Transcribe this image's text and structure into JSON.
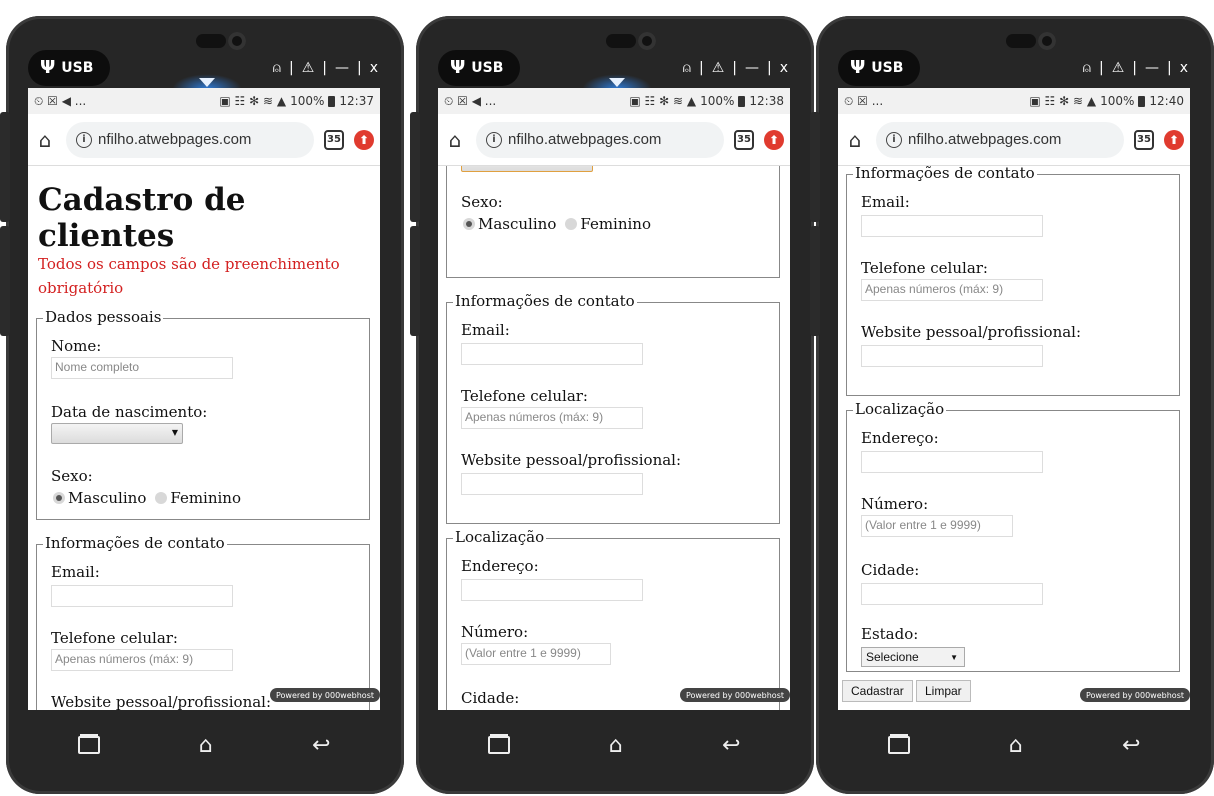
{
  "window": {
    "usb_label": "USB",
    "controls": [
      "⍝",
      "|",
      "⚠",
      "|",
      "—",
      "|",
      "x"
    ]
  },
  "phones": [
    {
      "time": "12:37",
      "battery": "100%",
      "notif": "⏲ ☒ ◀ ...",
      "url": "nfilho.atwebpages.com",
      "tabs_count": "35"
    },
    {
      "time": "12:38",
      "battery": "100%",
      "notif": "⏲ ☒ ◀ ...",
      "url": "nfilho.atwebpages.com",
      "tabs_count": "35"
    },
    {
      "time": "12:40",
      "battery": "100%",
      "notif": "⏲ ☒ ...",
      "url": "nfilho.atwebpages.com",
      "tabs_count": "35"
    }
  ],
  "form": {
    "title": "Cadastro de clientes",
    "required_note": "Todos os campos são de preenchimento obrigatório",
    "pessoais": {
      "legend": "Dados pessoais",
      "nome_label": "Nome:",
      "nome_placeholder": "Nome completo",
      "nascimento_label": "Data de nascimento:",
      "sexo_label": "Sexo:",
      "masculino": "Masculino",
      "feminino": "Feminino"
    },
    "contato": {
      "legend": "Informações de contato",
      "email_label": "Email:",
      "telefone_label": "Telefone celular:",
      "telefone_placeholder": "Apenas números (máx: 9)",
      "website_label": "Website pessoal/profissional:"
    },
    "localizacao": {
      "legend": "Localização",
      "endereco_label": "Endereço:",
      "numero_label": "Número:",
      "numero_placeholder": "(Valor entre 1 e 9999)",
      "cidade_label": "Cidade:",
      "estado_label": "Estado:",
      "estado_selected": "Selecione"
    },
    "cadastrar": "Cadastrar",
    "limpar": "Limpar",
    "powered_by": "Powered by 000webhost"
  }
}
